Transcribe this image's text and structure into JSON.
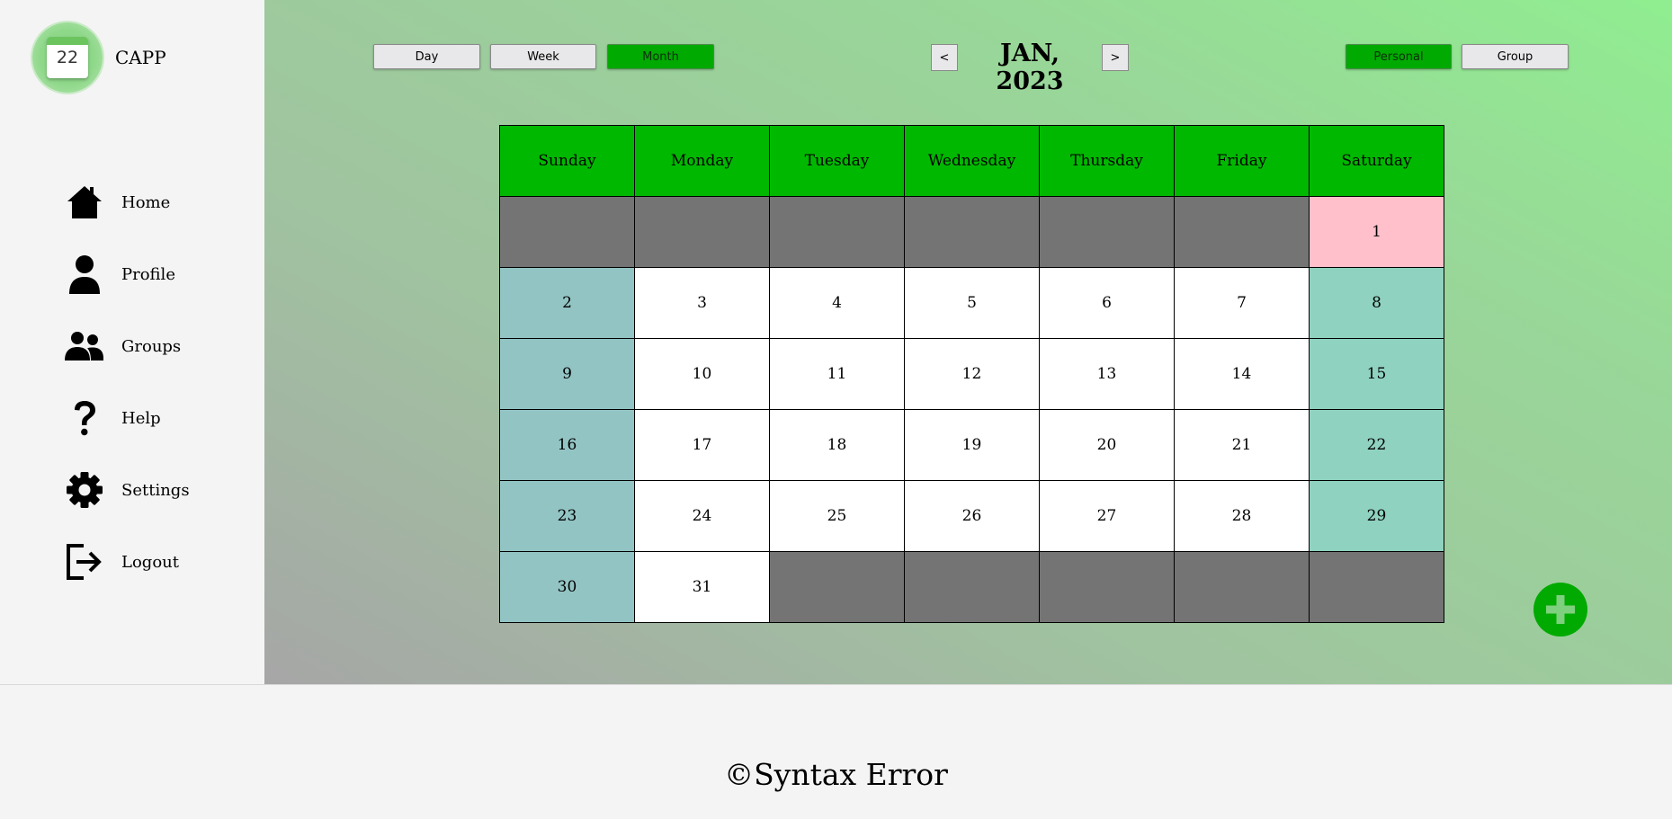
{
  "app": {
    "name": "CAPP",
    "logo_day": "22"
  },
  "sidebar": {
    "items": [
      {
        "label": "Home",
        "icon": "home-icon"
      },
      {
        "label": "Profile",
        "icon": "user-icon"
      },
      {
        "label": "Groups",
        "icon": "groups-icon"
      },
      {
        "label": "Help",
        "icon": "help-icon"
      },
      {
        "label": "Settings",
        "icon": "gear-icon"
      },
      {
        "label": "Logout",
        "icon": "logout-icon"
      }
    ]
  },
  "view_toggle": {
    "day": "Day",
    "week": "Week",
    "month": "Month",
    "active": "Month"
  },
  "calendar_type": {
    "personal": "Personal",
    "group": "Group",
    "active": "Personal"
  },
  "header": {
    "prev": "<",
    "next": ">",
    "month_title": "JAN, 2023"
  },
  "calendar": {
    "weekdays": [
      "Sunday",
      "Monday",
      "Tuesday",
      "Wednesday",
      "Thursday",
      "Friday",
      "Saturday"
    ],
    "weeks": [
      [
        "",
        "",
        "",
        "",
        "",
        "",
        "1"
      ],
      [
        "2",
        "3",
        "4",
        "5",
        "6",
        "7",
        "8"
      ],
      [
        "9",
        "10",
        "11",
        "12",
        "13",
        "14",
        "15"
      ],
      [
        "16",
        "17",
        "18",
        "19",
        "20",
        "21",
        "22"
      ],
      [
        "23",
        "24",
        "25",
        "26",
        "27",
        "28",
        "29"
      ],
      [
        "30",
        "31",
        "",
        "",
        "",
        "",
        ""
      ]
    ],
    "highlighted_day": "1"
  },
  "colors": {
    "accent": "#00aa00",
    "header_green": "#00b800",
    "empty_cell": "#747474",
    "sunday_cell": "#93c4c4",
    "saturday_cell": "#8fd2bf",
    "highlight_cell": "#ffc0cb"
  },
  "footer": {
    "copyright_symbol": "©",
    "copyright_text": "Syntax Error"
  }
}
